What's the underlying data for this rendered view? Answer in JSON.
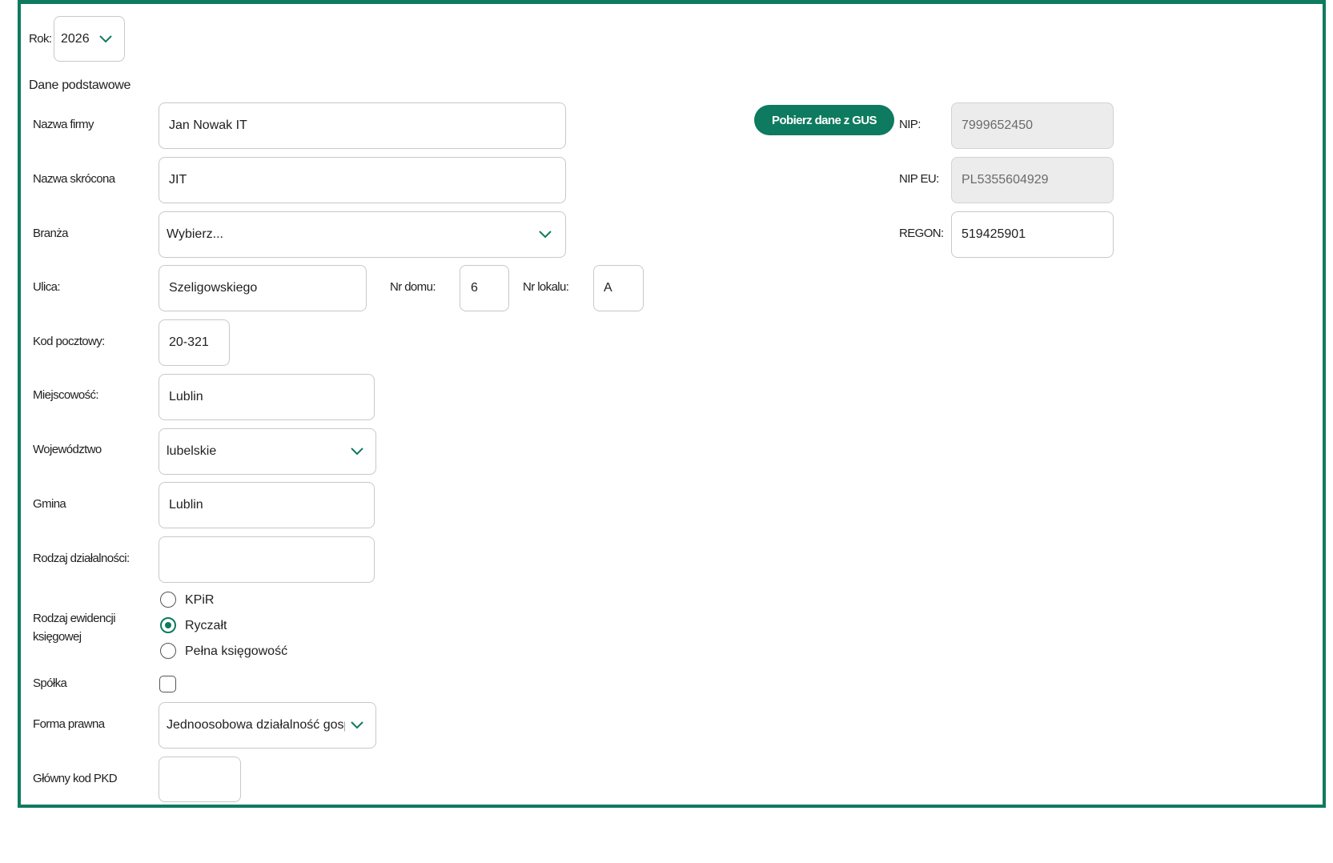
{
  "year": {
    "label": "Rok:",
    "value": "2026"
  },
  "section_title": "Dane podstawowe",
  "company_name": {
    "label": "Nazwa firmy",
    "value": "Jan Nowak IT"
  },
  "short_name": {
    "label": "Nazwa skrócona",
    "value": "JIT"
  },
  "industry": {
    "label": "Branża",
    "value": "Wybierz..."
  },
  "street": {
    "label": "Ulica:",
    "value": "Szeligowskiego"
  },
  "house_no": {
    "label": "Nr domu:",
    "value": "6"
  },
  "apartment_no": {
    "label": "Nr lokalu:",
    "value": "A"
  },
  "postal_code": {
    "label": "Kod pocztowy:",
    "value": "20-321"
  },
  "city": {
    "label": "Miejscowość:",
    "value": "Lublin"
  },
  "voivodeship": {
    "label": "Województwo",
    "value": "lubelskie"
  },
  "commune": {
    "label": "Gmina",
    "value": "Lublin"
  },
  "activity_type": {
    "label": "Rodzaj działalności:",
    "value": ""
  },
  "accounting": {
    "label": "Rodzaj ewidencji księgowej",
    "options": [
      "KPiR",
      "Ryczałt",
      "Pełna księgowość"
    ],
    "selected": "Ryczałt"
  },
  "partnership": {
    "label": "Spółka",
    "checked": false
  },
  "legal_form": {
    "label": "Forma prawna",
    "value": "Jednoosobowa działalność gospodarcza"
  },
  "pkd": {
    "label": "Główny kod PKD",
    "value": ""
  },
  "gus_button": "Pobierz dane z GUS",
  "nip": {
    "label": "NIP:",
    "value": "7999652450"
  },
  "nip_eu": {
    "label": "NIP EU:",
    "value": "PL5355604929"
  },
  "regon": {
    "label": "REGON:",
    "value": "519425901"
  },
  "colors": {
    "accent": "#0e7a5f",
    "disabled_bg": "#ececec",
    "border": "#c8c8c8"
  }
}
